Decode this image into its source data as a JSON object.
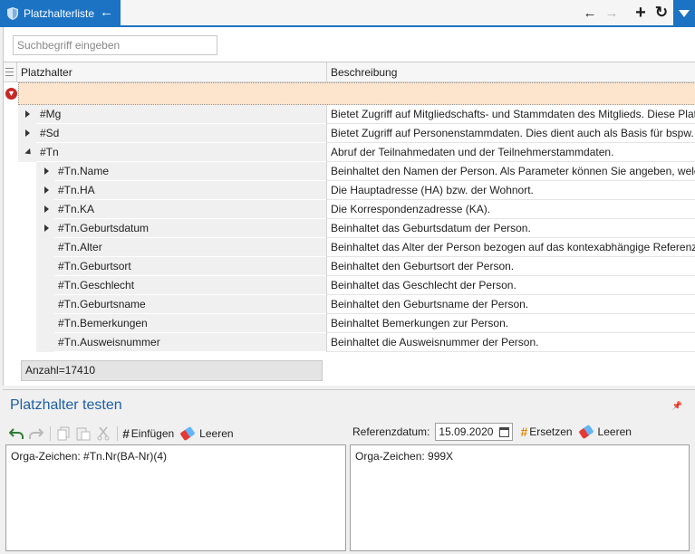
{
  "tab": {
    "title": "Platzhalterliste",
    "back_icon": "arrow-left-icon"
  },
  "toolbar": {
    "back": "←",
    "forward": "→",
    "add": "+",
    "refresh": "↻"
  },
  "search": {
    "placeholder": "Suchbegriff eingeben",
    "value": ""
  },
  "grid": {
    "columns": [
      "Platzhalter",
      "Beschreibung"
    ],
    "rows": [
      {
        "name": "#Mg",
        "desc": "Bietet Zugriff auf Mitgliedschafts- und Stammdaten des Mitglieds. Diese Plat",
        "expander": "right"
      },
      {
        "name": "#Sd",
        "desc": "Bietet Zugriff auf Personenstammdaten. Dies dient auch als Basis für bspw. T",
        "expander": "right"
      },
      {
        "name": "#Tn",
        "desc": "Abruf der Teilnahmedaten und der Teilnehmerstammdaten.",
        "expander": "down"
      },
      {
        "name": "#Tn.Name",
        "desc": "Beinhaltet den Namen der Person. Als Parameter können Sie angeben, welch",
        "expander": "right"
      },
      {
        "name": "#Tn.HA",
        "desc": "Die Hauptadresse (HA) bzw. der Wohnort.",
        "expander": "right"
      },
      {
        "name": "#Tn.KA",
        "desc": "Die Korrespondenzadresse (KA).",
        "expander": "right"
      },
      {
        "name": "#Tn.Geburtsdatum",
        "desc": "Beinhaltet das Geburtsdatum der Person.",
        "expander": "right"
      },
      {
        "name": "#Tn.Alter",
        "desc": "Beinhaltet das Alter der Person bezogen auf das kontexabhängige Referenzd",
        "expander": ""
      },
      {
        "name": "#Tn.Geburtsort",
        "desc": "Beinhaltet den Geburtsort der Person.",
        "expander": ""
      },
      {
        "name": "#Tn.Geschlecht",
        "desc": "Beinhaltet das Geschlecht der Person.",
        "expander": ""
      },
      {
        "name": "#Tn.Geburtsname",
        "desc": "Beinhaltet den Geburtsname der Person.",
        "expander": ""
      },
      {
        "name": "#Tn.Bemerkungen",
        "desc": "Beinhaltet Bemerkungen zur Person.",
        "expander": ""
      },
      {
        "name": "#Tn.Ausweisnummer",
        "desc": "Beinhaltet die Ausweisnummer der Person.",
        "expander": ""
      }
    ],
    "count": "Anzahl=17410"
  },
  "test_panel": {
    "title": "Platzhalter testen",
    "insert_label": "Einfügen",
    "clear_label": "Leeren",
    "ref_label": "Referenzdatum:",
    "ref_date": "15.09.2020",
    "replace_label": "Ersetzen",
    "clear2_label": "Leeren",
    "input_text": "Orga-Zeichen: #Tn.Nr(BA-Nr)(4)",
    "output_text": "Orga-Zeichen: 999X"
  },
  "colors": {
    "accent": "#1c73c4",
    "filter_row": "#fde4cc",
    "title": "#1c5fa5"
  }
}
